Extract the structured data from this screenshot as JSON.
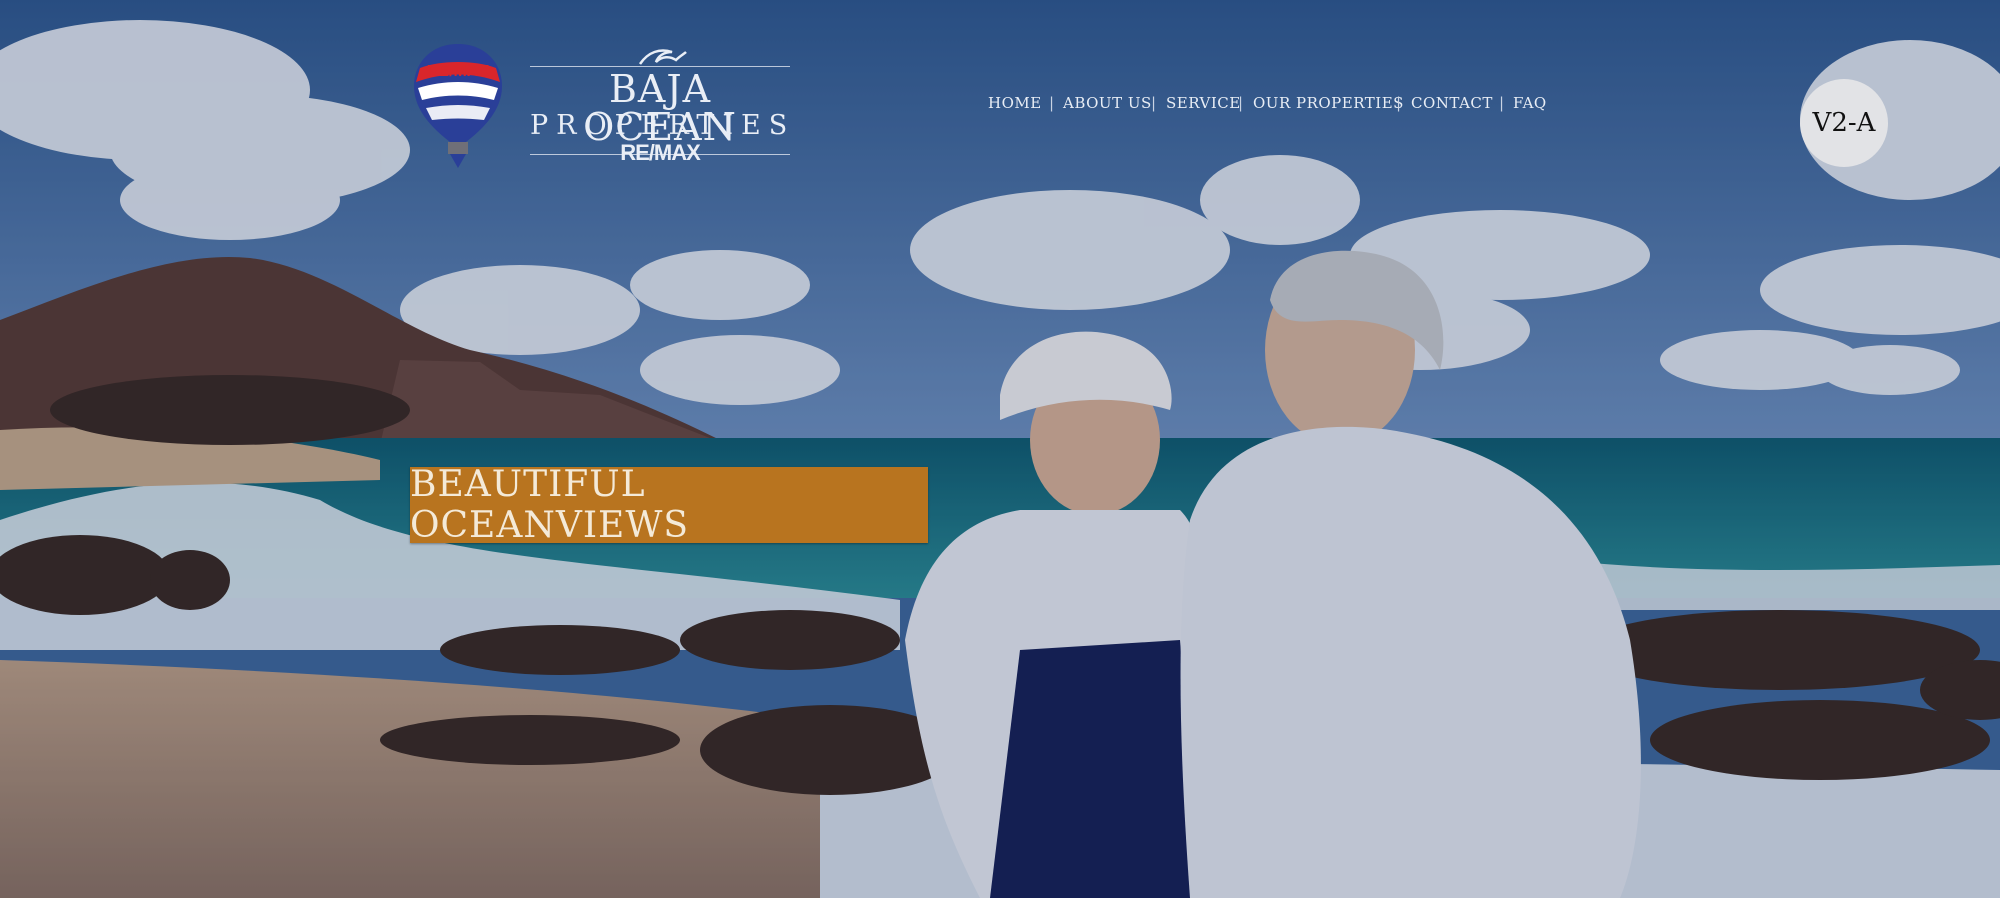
{
  "logo": {
    "balloon_text": "RE/MAX",
    "brand_title": "BAJA OCEAN",
    "brand_subtitle": "PROPERTIES",
    "brand_remax": "RE/MAX"
  },
  "nav": {
    "items": [
      "HOME",
      "ABOUT US",
      "SERVICE",
      "OUR PROPERTIES",
      "CONTACT",
      "FAQ"
    ],
    "separator": "|"
  },
  "badge": {
    "label": "V2-A"
  },
  "hero": {
    "headline": "BEAUTIFUL OCEANVIEWS"
  },
  "colors": {
    "sky": "#3f6aa0",
    "ocean": "#1f7f8a",
    "banner": "#b8741f",
    "badge_bg": "#e2e3e6",
    "nav_text": "#e8edf5"
  }
}
